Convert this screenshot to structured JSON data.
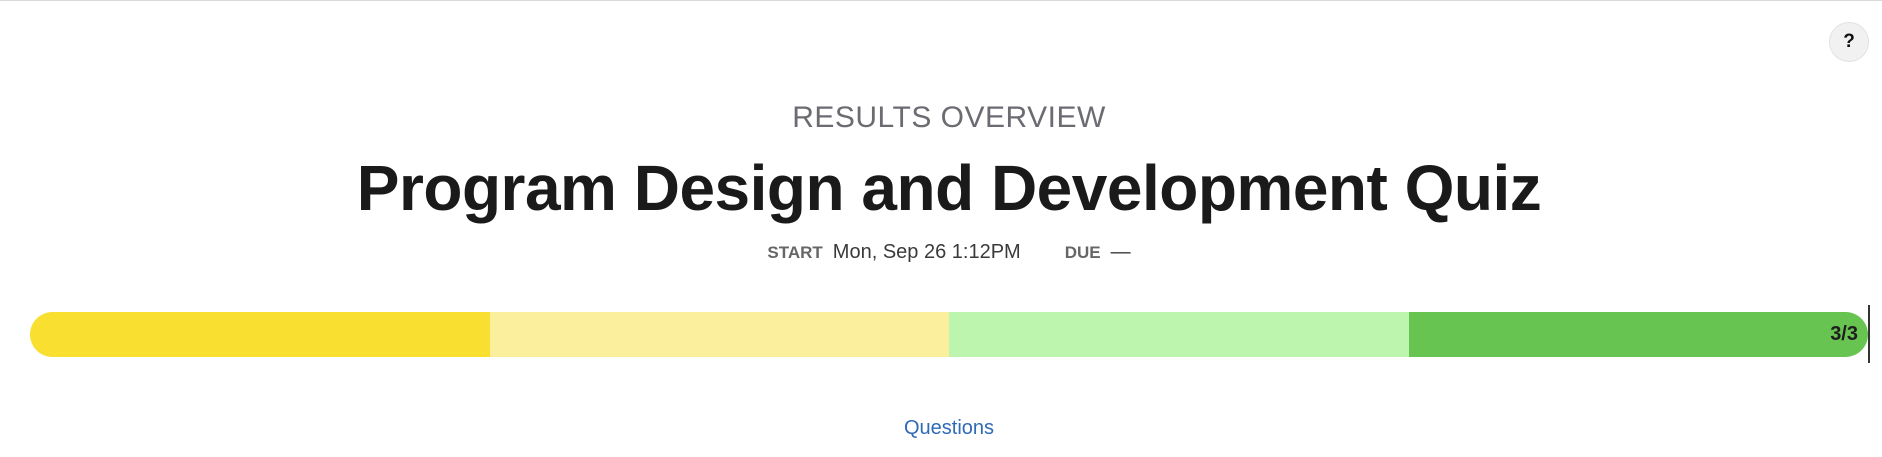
{
  "help_label": "?",
  "header": {
    "eyebrow": "RESULTS OVERVIEW",
    "title": "Program Design and Development Quiz"
  },
  "dates": {
    "start_label": "START",
    "start_value": "Mon, Sep 26 1:12PM",
    "due_label": "DUE",
    "due_value": "—"
  },
  "progress": {
    "label": "3/3",
    "segments": [
      {
        "color": "#f9df30"
      },
      {
        "color": "#fbee9d"
      },
      {
        "color": "#bdf5ae"
      },
      {
        "color": "#67c451"
      }
    ]
  },
  "tabs": {
    "questions": "Questions"
  }
}
